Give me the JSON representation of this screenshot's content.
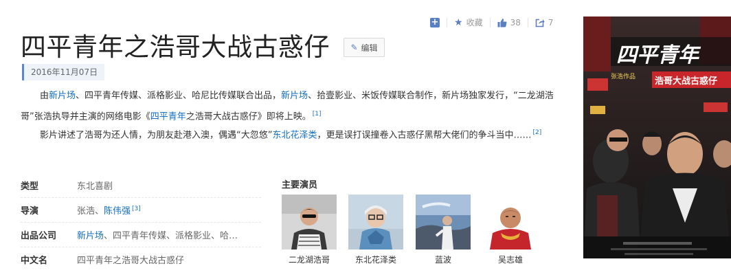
{
  "actions": {
    "favorite_label": "收藏",
    "like_count": "38",
    "share_count": "7"
  },
  "title": "四平青年之浩哥大战古惑仔",
  "edit_label": "编辑",
  "date": "2016年11月07日",
  "p1": {
    "s1": "由",
    "l1": "新片场",
    "s2": "、四平青年传媒、派格影业、哈尼比传媒联合出品，",
    "l2": "新片场",
    "s3": "、拾壹影业、米饭传媒联合制作，新片场独家发行，“二龙湖浩哥”张浩执导并主演的网络电影《",
    "l3": "四平青年",
    "s4": "之浩哥大战古惑仔》即将上映。",
    "ref": "[1]"
  },
  "p2": {
    "s1": "影片讲述了浩哥为还人情，为朋友赴港入澳，偶遇“大忽悠”",
    "l1": "东北花泽类",
    "s2": "，更是误打误撞卷入古惑仔黑帮大佬们的争斗当中……",
    "ref": "[2]"
  },
  "info": {
    "genre_label": "类型",
    "genre_value": "东北喜剧",
    "director_label": "导演",
    "director_v1": "张浩、",
    "director_link": "陈伟强",
    "director_ref": "[3]",
    "company_label": "出品公司",
    "company_link": "新片场",
    "company_rest": "、四平青年传媒、派格影业、哈…",
    "cn_label": "中文名",
    "cn_value": "四平青年之浩哥大战古惑仔"
  },
  "cast_title": "主要演员",
  "cast": [
    {
      "name": "二龙湖浩哥"
    },
    {
      "name": "东北花泽类"
    },
    {
      "name": "蓝波"
    },
    {
      "name": "吴志雄"
    }
  ],
  "poster": {
    "title_line1": "四平青年",
    "title_line2": "浩哥大战古惑仔",
    "credit": "张浩作品"
  },
  "colors": {
    "link": "#136ec2",
    "accent": "#5a7fc2"
  }
}
